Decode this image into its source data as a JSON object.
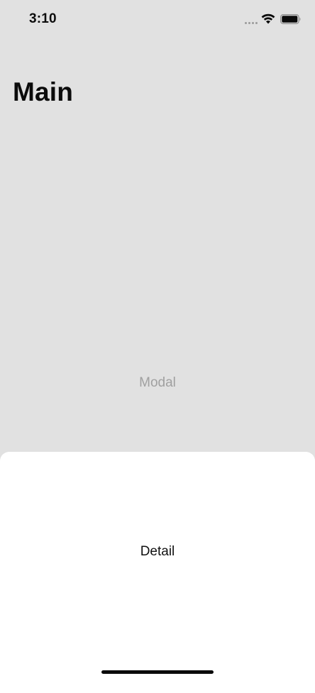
{
  "status_bar": {
    "time": "3:10",
    "icons": [
      "signal-dots-icon",
      "wifi-icon",
      "battery-icon"
    ]
  },
  "header": {
    "title": "Main"
  },
  "main": {
    "modal_label": "Modal"
  },
  "sheet": {
    "detail_label": "Detail"
  },
  "colors": {
    "background": "#e1e1e1",
    "sheet": "#ffffff",
    "modal_text": "#a0a0a0",
    "text": "#111111"
  }
}
